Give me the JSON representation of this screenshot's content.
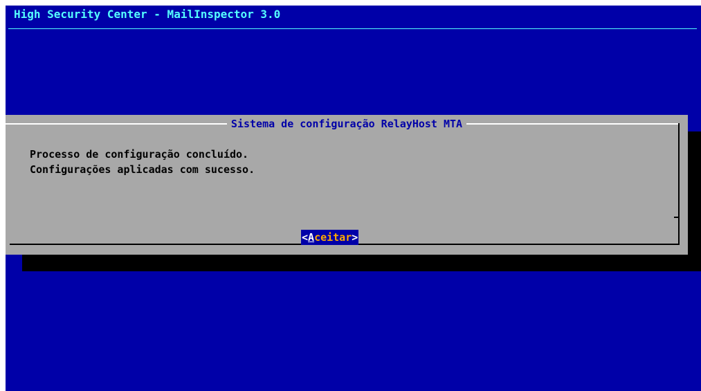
{
  "backtitle": "High Security Center - MailInspector 3.0",
  "dialog": {
    "title": "Sistema de configuração RelayHost MTA",
    "lines": [
      "Processo de configuração concluído.",
      "Configurações aplicadas com sucesso."
    ],
    "button": {
      "open": "<",
      "hotkey": "A",
      "rest": "ceitar",
      "close": ">"
    }
  },
  "colors": {
    "background": "#0000a8",
    "backtitle": "#55ffff",
    "dialog": "#a8a8a8",
    "dialog_title": "#0000a8",
    "button_bg": "#0000a8",
    "button_hot": "#ffffff",
    "button_text": "#ffaa00"
  }
}
